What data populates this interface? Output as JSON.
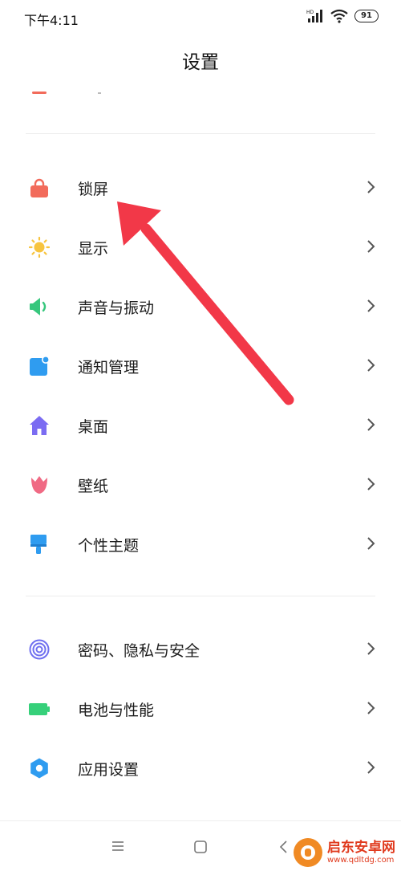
{
  "status_bar": {
    "time": "下午4:11",
    "battery": "91",
    "signal_label": "HD"
  },
  "header": {
    "title": "设置"
  },
  "sections": [
    {
      "items": [
        {
          "label": "锁屏",
          "icon": "lock-icon",
          "color": "#f26b5b"
        },
        {
          "label": "显示",
          "icon": "sun-icon",
          "color": "#f7c43f"
        },
        {
          "label": "声音与振动",
          "icon": "speaker-icon",
          "color": "#37c77d"
        },
        {
          "label": "通知管理",
          "icon": "notification-icon",
          "color": "#2f9cf0"
        },
        {
          "label": "桌面",
          "icon": "home-icon",
          "color": "#7b6cf2"
        },
        {
          "label": "壁纸",
          "icon": "tulip-icon",
          "color": "#f06a84"
        },
        {
          "label": "个性主题",
          "icon": "brush-icon",
          "color": "#2f9cf0"
        }
      ]
    },
    {
      "items": [
        {
          "label": "密码、隐私与安全",
          "icon": "fingerprint-icon",
          "color": "#6f6ff0"
        },
        {
          "label": "电池与性能",
          "icon": "battery-icon",
          "color": "#36d07a"
        },
        {
          "label": "应用设置",
          "icon": "gear-icon",
          "color": "#2f9cf0"
        }
      ]
    }
  ],
  "annotation": {
    "color": "#f23848",
    "points_to": "锁屏"
  },
  "watermark": {
    "title": "启东安卓网",
    "url": "www.qdltdg.com"
  }
}
